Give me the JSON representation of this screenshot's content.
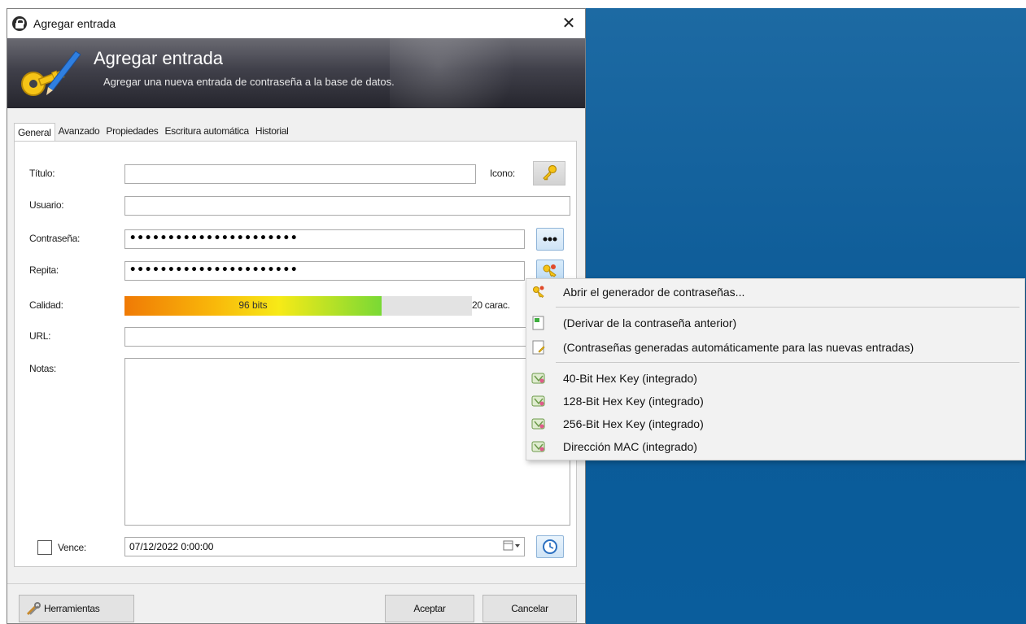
{
  "window": {
    "title": "Agregar entrada",
    "close_glyph": "✕"
  },
  "banner": {
    "title": "Agregar entrada",
    "subtitle": "Agregar una nueva entrada de contraseña a la base de datos."
  },
  "tabs": [
    {
      "label": "General",
      "active": true
    },
    {
      "label": "Avanzado",
      "active": false
    },
    {
      "label": "Propiedades",
      "active": false
    },
    {
      "label": "Escritura automática",
      "active": false
    },
    {
      "label": "Historial",
      "active": false
    }
  ],
  "form": {
    "title_label": "Título:",
    "title_value": "",
    "icon_label": "Icono:",
    "user_label": "Usuario:",
    "user_value": "",
    "password_label": "Contraseña:",
    "password_value": "••••••••••••••••••••••",
    "repeat_label": "Repita:",
    "repeat_value": "••••••••••••••••••••••",
    "quality_label": "Calidad:",
    "quality_text": "96 bits",
    "quality_fraction": 0.74,
    "char_count": "20 carac.",
    "url_label": "URL:",
    "url_value": "",
    "notes_label": "Notas:",
    "notes_value": "",
    "expires_label": "Vence:",
    "expires_checked": false,
    "expires_value": "07/12/2022  0:00:00"
  },
  "footer": {
    "tools_label": "Herramientas",
    "ok_label": "Aceptar",
    "cancel_label": "Cancelar"
  },
  "context_menu": {
    "items": [
      {
        "label": "Abrir el generador de contraseñas...",
        "icon": "key-generator-icon"
      },
      {
        "label": "(Derivar de la contraseña anterior)",
        "icon": "derive-icon"
      },
      {
        "label": "(Contraseñas generadas automáticamente para las nuevas entradas)",
        "icon": "auto-generated-icon"
      },
      {
        "label": "40-Bit Hex Key (integrado)",
        "icon": "profile-icon"
      },
      {
        "label": "128-Bit Hex Key (integrado)",
        "icon": "profile-icon"
      },
      {
        "label": "256-Bit Hex Key (integrado)",
        "icon": "profile-icon"
      },
      {
        "label": "Dirección MAC (integrado)",
        "icon": "profile-icon"
      }
    ]
  },
  "colors": {
    "desktop": "#0b5a97",
    "banner_dark": "#25252d",
    "quality_start": "#f07a05",
    "quality_end": "#79d935"
  }
}
